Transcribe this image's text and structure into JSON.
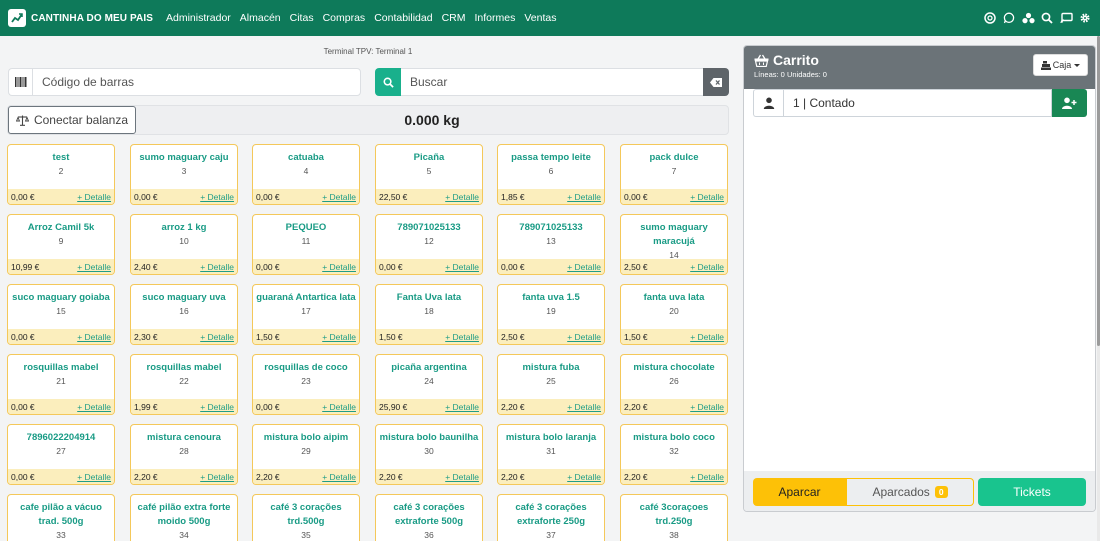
{
  "brand": {
    "name": "CANTINHA DO MEU PAIS",
    "icon": "chart-line-icon"
  },
  "nav": {
    "items": [
      "Administrador",
      "Almacén",
      "Citas",
      "Compras",
      "Contabilidad",
      "CRM",
      "Informes",
      "Ventas"
    ]
  },
  "nav_icons": [
    "support-icon",
    "whatsapp-icon",
    "share-icon",
    "search-icon",
    "cast-icon",
    "gear-icon"
  ],
  "terminal": {
    "label": "Terminal TPV: Terminal 1"
  },
  "barcode": {
    "placeholder": "Código de barras",
    "icon": "barcode-icon"
  },
  "search": {
    "placeholder": "Buscar",
    "icon": "search-icon",
    "clear_icon": "backspace-icon"
  },
  "scale": {
    "button_label": "Conectar balanza",
    "icon": "balance-scale-icon",
    "weight": "0.000 kg"
  },
  "products": [
    {
      "name": "test",
      "ref": "2",
      "price": "0,00 €",
      "detail": "+ Detalle"
    },
    {
      "name": "sumo maguary caju",
      "ref": "3",
      "price": "0,00 €",
      "detail": "+ Detalle"
    },
    {
      "name": "catuaba",
      "ref": "4",
      "price": "0,00 €",
      "detail": "+ Detalle"
    },
    {
      "name": "Picaña",
      "ref": "5",
      "price": "22,50 €",
      "detail": "+ Detalle"
    },
    {
      "name": "passa tempo leite",
      "ref": "6",
      "price": "1,85 €",
      "detail": "+ Detalle"
    },
    {
      "name": "pack dulce",
      "ref": "7",
      "price": "0,00 €",
      "detail": "+ Detalle"
    },
    {
      "name": "Arroz Camil 5k",
      "ref": "9",
      "price": "10,99 €",
      "detail": "+ Detalle"
    },
    {
      "name": "arroz 1 kg",
      "ref": "10",
      "price": "2,40 €",
      "detail": "+ Detalle"
    },
    {
      "name": "PEQUEO",
      "ref": "11",
      "price": "0,00 €",
      "detail": "+ Detalle"
    },
    {
      "name": "789071025133",
      "ref": "12",
      "price": "0,00 €",
      "detail": "+ Detalle"
    },
    {
      "name": "789071025133",
      "ref": "13",
      "price": "0,00 €",
      "detail": "+ Detalle"
    },
    {
      "name": "sumo maguary maracujá",
      "ref": "14",
      "price": "2,50 €",
      "detail": "+ Detalle"
    },
    {
      "name": "suco maguary goiaba",
      "ref": "15",
      "price": "0,00 €",
      "detail": "+ Detalle"
    },
    {
      "name": "suco maguary uva",
      "ref": "16",
      "price": "2,30 €",
      "detail": "+ Detalle"
    },
    {
      "name": "guaraná Antartica lata",
      "ref": "17",
      "price": "1,50 €",
      "detail": "+ Detalle"
    },
    {
      "name": "Fanta Uva lata",
      "ref": "18",
      "price": "1,50 €",
      "detail": "+ Detalle"
    },
    {
      "name": "fanta uva 1.5",
      "ref": "19",
      "price": "2,50 €",
      "detail": "+ Detalle"
    },
    {
      "name": "fanta uva lata",
      "ref": "20",
      "price": "1,50 €",
      "detail": "+ Detalle"
    },
    {
      "name": "rosquillas mabel",
      "ref": "21",
      "price": "0,00 €",
      "detail": "+ Detalle"
    },
    {
      "name": "rosquillas mabel",
      "ref": "22",
      "price": "1,99 €",
      "detail": "+ Detalle"
    },
    {
      "name": "rosquillas de coco",
      "ref": "23",
      "price": "0,00 €",
      "detail": "+ Detalle"
    },
    {
      "name": "picaña argentina",
      "ref": "24",
      "price": "25,90 €",
      "detail": "+ Detalle"
    },
    {
      "name": "mistura fuba",
      "ref": "25",
      "price": "2,20 €",
      "detail": "+ Detalle"
    },
    {
      "name": "mistura chocolate",
      "ref": "26",
      "price": "2,20 €",
      "detail": "+ Detalle"
    },
    {
      "name": "7896022204914",
      "ref": "27",
      "price": "0,00 €",
      "detail": "+ Detalle"
    },
    {
      "name": "mistura cenoura",
      "ref": "28",
      "price": "2,20 €",
      "detail": "+ Detalle"
    },
    {
      "name": "mistura bolo aipim",
      "ref": "29",
      "price": "2,20 €",
      "detail": "+ Detalle"
    },
    {
      "name": "mistura bolo baunilha",
      "ref": "30",
      "price": "2,20 €",
      "detail": "+ Detalle"
    },
    {
      "name": "mistura bolo laranja",
      "ref": "31",
      "price": "2,20 €",
      "detail": "+ Detalle"
    },
    {
      "name": "mistura bolo coco",
      "ref": "32",
      "price": "2,20 €",
      "detail": "+ Detalle"
    },
    {
      "name": "cafe pilão a vácuo trad. 500g",
      "ref": "33",
      "price": "",
      "detail": ""
    },
    {
      "name": "café pilão extra forte moido 500g",
      "ref": "34",
      "price": "",
      "detail": ""
    },
    {
      "name": "café 3 corações trd.500g",
      "ref": "35",
      "price": "",
      "detail": ""
    },
    {
      "name": "café 3 corações extraforte 500g",
      "ref": "36",
      "price": "",
      "detail": ""
    },
    {
      "name": "café 3 corações extraforte 250g",
      "ref": "37",
      "price": "",
      "detail": ""
    },
    {
      "name": "café 3coraçoes trd.250g",
      "ref": "38",
      "price": "",
      "detail": ""
    }
  ],
  "cart": {
    "title": "Carrito",
    "icon": "shopping-basket-icon",
    "subtitle": "Líneas: 0 Unidades: 0",
    "caja_label": "Caja",
    "customer_value": "1 | Contado",
    "aparcar_label": "Aparcar",
    "aparcados_label": "Aparcados",
    "aparcados_count": "0",
    "tickets_label": "Tickets"
  },
  "colors": {
    "navbar": "#0e7a5a",
    "accent": "#199b85",
    "card_border": "#f4c85a",
    "warning": "#fdc107",
    "tickets": "#19c48e"
  }
}
